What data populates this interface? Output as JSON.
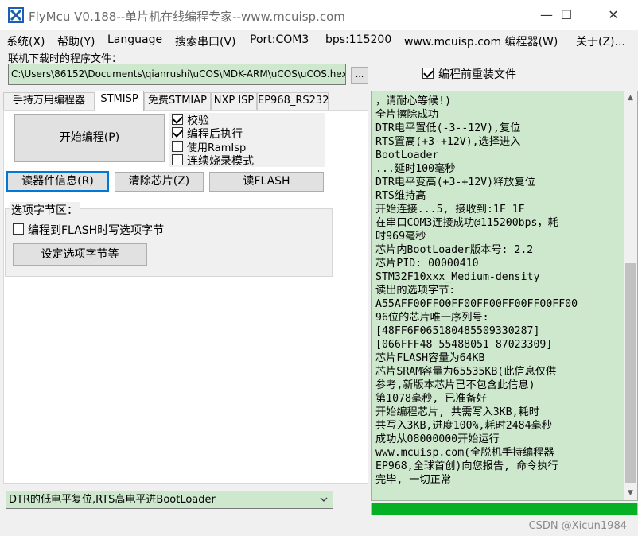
{
  "window": {
    "title": "FlyMcu V0.188--单片机在线编程专家--www.mcuisp.com",
    "minimize": "—",
    "maximize": "☐",
    "close": "✕"
  },
  "menu": [
    "系统(X)",
    "帮助(Y)",
    "Language",
    "搜索串口(V)",
    "Port:COM3",
    "bps:115200",
    "www.mcuisp.com 编程器(W)",
    "关于(Z)..."
  ],
  "file": {
    "label": "联机下载时的程序文件：",
    "path": "C:\\Users\\86152\\Documents\\qianrushi\\uCOS\\MDK-ARM\\uCOS\\uCOS.hex",
    "browse_label": "...",
    "reload_label": "编程前重装文件",
    "reload_checked": true
  },
  "tabs": [
    "手持万用编程器",
    "STMISP",
    "免费STMIAP",
    "NXP ISP",
    "EP968_RS232"
  ],
  "active_tab": "STMISP",
  "stmisp": {
    "start_button": "开始编程(P)",
    "checkboxes": [
      {
        "label": "校验",
        "checked": true
      },
      {
        "label": "编程后执行",
        "checked": true
      },
      {
        "label": "使用RamIsp",
        "checked": false
      },
      {
        "label": "连续烧录模式",
        "checked": false
      }
    ],
    "read_info_button": "读器件信息(R)",
    "erase_button": "清除芯片(Z)",
    "read_flash_button": "读FLASH",
    "options": {
      "title": "选项字节区：",
      "write_option_label": "编程到FLASH时写选项字节",
      "write_option_checked": false,
      "set_button": "设定选项字节等"
    }
  },
  "boot_mode": "DTR的低电平复位,RTS高电平进BootLoader",
  "log": [
    "，请耐心等候!)",
    "全片擦除成功",
    "DTR电平置低(-3--12V),复位",
    "RTS置高(+3-+12V),选择进入",
    "BootLoader",
    "...延时100毫秒",
    "DTR电平变高(+3-+12V)释放复位",
    "RTS维持高",
    "开始连接...5, 接收到:1F 1F",
    "在串口COM3连接成功@115200bps，耗",
    "时969毫秒",
    "芯片内BootLoader版本号: 2.2",
    "芯片PID: 00000410",
    "STM32F10xxx_Medium-density",
    "读出的选项字节:",
    "A55AFF00FF00FF00FF00FF00FF00FF00",
    "96位的芯片唯一序列号:",
    "[48FF6F065180485509330287]",
    "[066FFF48 55488051 87023309]",
    "芯片FLASH容量为64KB",
    "芯片SRAM容量为65535KB(此信息仅供",
    "参考,新版本芯片已不包含此信息)",
    "第1078毫秒, 已准备好",
    "开始编程芯片, 共需写入3KB,耗时",
    "共写入3KB,进度100%,耗时2484毫秒",
    "成功从08000000开始运行",
    "www.mcuisp.com(全脱机手持编程器",
    "EP968,全球首创)向您报告, 命令执行",
    "完毕, 一切正常"
  ],
  "progress_percent": 100,
  "watermark": "CSDN @Xicun1984",
  "colors": {
    "log_bg": "#cde8cd",
    "progress_fill": "#06b025",
    "focus_border": "#0078d7"
  }
}
